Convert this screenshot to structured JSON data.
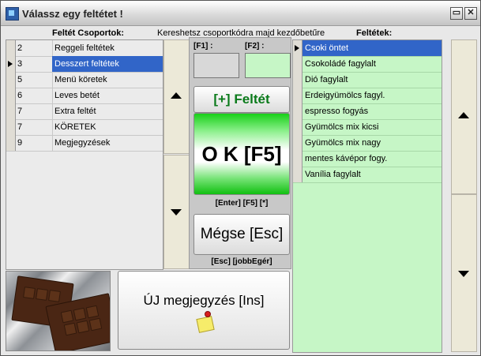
{
  "window": {
    "title": "Válassz egy feltétet !",
    "controls": {
      "restore": "▭",
      "close": "✕"
    }
  },
  "headers": {
    "groups": "Feltét Csoportok:",
    "hint": "Kereshetsz csoportkódra majd kezdőbetűre",
    "features": "Feltétek:"
  },
  "groups": {
    "rows": [
      {
        "code": "2",
        "name": "Reggeli feltétek",
        "selected": false,
        "current": false
      },
      {
        "code": "3",
        "name": "Desszert feltétek",
        "selected": true,
        "current": true
      },
      {
        "code": "5",
        "name": "Menü köretek",
        "selected": false,
        "current": false
      },
      {
        "code": "6",
        "name": "Leves betét",
        "selected": false,
        "current": false
      },
      {
        "code": "7",
        "name": "Extra feltét",
        "selected": false,
        "current": false
      },
      {
        "code": "7",
        "name": "KÖRETEK",
        "selected": false,
        "current": false
      },
      {
        "code": "9",
        "name": "Megjegyzések",
        "selected": false,
        "current": false
      }
    ]
  },
  "filters": {
    "f1_label": "[F1] :",
    "f2_label": "[F2] :",
    "f1_value": "",
    "f2_value": ""
  },
  "buttons": {
    "add_feature": "[+] Feltét",
    "ok": "O K [F5]",
    "ok_hint": "[Enter] [F5] [*]",
    "cancel": "Mégse [Esc]",
    "cancel_hint": "[Esc] [jobbEgér]",
    "new_note": "ÚJ megjegyzés [Ins]"
  },
  "features": {
    "rows": [
      {
        "name": "Csoki öntet",
        "selected": true,
        "current": true
      },
      {
        "name": "Csokoládé fagylalt",
        "selected": false,
        "current": false
      },
      {
        "name": "Dió fagylalt",
        "selected": false,
        "current": false
      },
      {
        "name": "Erdeigyümölcs fagyl.",
        "selected": false,
        "current": false
      },
      {
        "name": "espresso fogyás",
        "selected": false,
        "current": false
      },
      {
        "name": "Gyümölcs mix kicsi",
        "selected": false,
        "current": false
      },
      {
        "name": "Gyümölcs mix nagy",
        "selected": false,
        "current": false
      },
      {
        "name": "mentes kávépor fogy.",
        "selected": false,
        "current": false
      },
      {
        "name": "Vanília fagylalt",
        "selected": false,
        "current": false
      }
    ]
  },
  "colors": {
    "selection": "#3165c8",
    "features_bg": "#c6f6c6",
    "add_button_text": "#0a7a1a",
    "ok_green": "#18d018"
  },
  "icons": {
    "scroll_up": "triangle-up",
    "scroll_down": "triangle-down",
    "row_pointer": "triangle-right",
    "note": "sticky-note-icon",
    "image": "chocolate-image"
  }
}
